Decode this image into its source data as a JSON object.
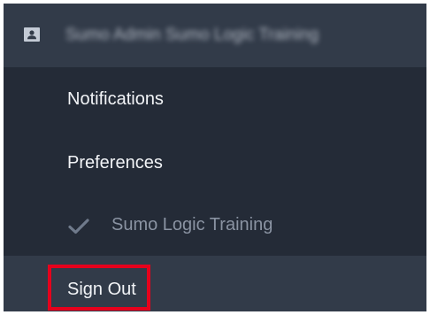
{
  "header": {
    "title": "Sumo Admin Sumo Logic Training",
    "icon": "contact-card-icon"
  },
  "menu": {
    "items": [
      {
        "label": "Notifications"
      },
      {
        "label": "Preferences"
      },
      {
        "label": "Sumo Logic Training",
        "icon": "check-icon"
      },
      {
        "label": "Sign Out"
      }
    ]
  },
  "colors": {
    "menu_background": "#242b37",
    "header_background": "#323b49",
    "highlight": "#e6001c"
  }
}
